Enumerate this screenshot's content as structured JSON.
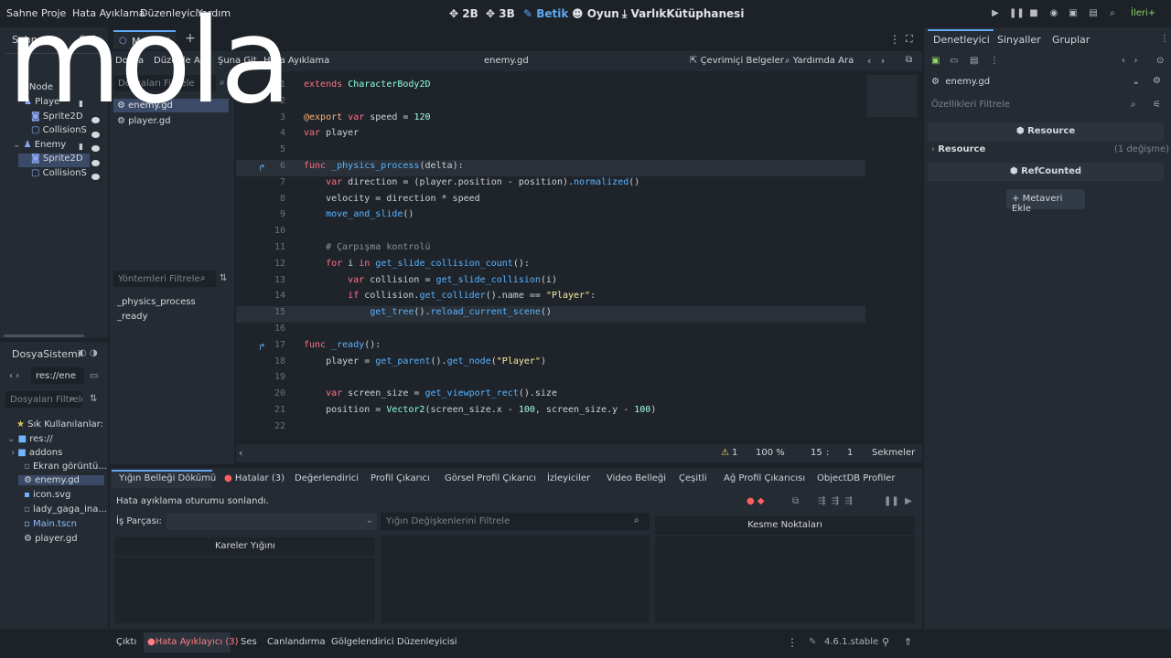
{
  "menu": [
    "Sahne",
    "Proje",
    "Hata Ayıklama",
    "Düzenleyici",
    "Yardım"
  ],
  "workspaces": [
    {
      "icon": "2d-icon",
      "label": "2B"
    },
    {
      "icon": "3d-icon",
      "label": "3B"
    },
    {
      "icon": "script-icon",
      "label": "Betik"
    },
    {
      "icon": "game-icon",
      "label": "Oyun"
    },
    {
      "icon": "asset-library-icon",
      "label": "VarlıkKütüphanesi"
    }
  ],
  "renderer": "İleri+",
  "overlay_text": "mola",
  "scene_panel": {
    "title": "Sahne",
    "nodes": [
      {
        "label": "Node2D",
        "display": "Node"
      },
      {
        "label": "Player",
        "display": "Playe"
      },
      {
        "label": "Sprite2D",
        "display": "Sprite2D"
      },
      {
        "label": "CollisionShape2D",
        "display": "CollisionS"
      },
      {
        "label": "Enemy",
        "display": "Enemy"
      },
      {
        "label": "Sprite2D",
        "display": "Sprite2D"
      },
      {
        "label": "CollisionShape2D",
        "display": "CollisionS"
      }
    ]
  },
  "editor_tabs": {
    "main_tab": "Main"
  },
  "script_menu": {
    "file": "Dosya",
    "edit": "Düzenle",
    "search": "Ara",
    "goto": "Şuna Git",
    "debug": "Hata Ayıklama"
  },
  "script_title": "enemy.gd",
  "online_docs": "Çevrimiçi Belgeler",
  "help_search": "Yardımda Ara",
  "script_filter_placeholder": "Dosyaları Filtrele",
  "script_list": [
    "enemy.gd",
    "player.gd"
  ],
  "method_filter_placeholder": "Yöntemleri Filtrele",
  "methods": [
    "_physics_process",
    "_ready"
  ],
  "code_lines": [
    {
      "n": "1",
      "html": "<span class='kw'>extends</span> <span class='ty'>CharacterBody2D</span>"
    },
    {
      "n": "2",
      "html": ""
    },
    {
      "n": "3",
      "html": "<span class='ann'>@export</span> <span class='kw'>var</span> speed = <span class='num'>120</span>"
    },
    {
      "n": "4",
      "html": "<span class='kw'>var</span> player"
    },
    {
      "n": "5",
      "html": ""
    },
    {
      "n": "6",
      "html": "<span class='kw'>func</span> <span class='fn'>_physics_process</span>(delta):"
    },
    {
      "n": "7",
      "html": "    <span class='kw'>var</span> direction = (player.position - position).<span class='fn'>normalized</span>()"
    },
    {
      "n": "8",
      "html": "    velocity = direction * speed"
    },
    {
      "n": "9",
      "html": "    <span class='fn'>move_and_slide</span>()"
    },
    {
      "n": "10",
      "html": ""
    },
    {
      "n": "11",
      "html": "    <span class='cm'># Çarpışma kontrolü</span>"
    },
    {
      "n": "12",
      "html": "    <span class='kw'>for</span> i <span class='kw'>in</span> <span class='fn'>get_slide_collision_count</span>():"
    },
    {
      "n": "13",
      "html": "        <span class='kw'>var</span> collision = <span class='fn'>get_slide_collision</span>(i)"
    },
    {
      "n": "14",
      "html": "        <span class='kw'>if</span> collision.<span class='fn'>get_collider</span>().name == <span class='str'>\"Player\"</span>:"
    },
    {
      "n": "15",
      "html": "            <span class='fn'>get_tree</span>().<span class='fn'>reload_current_scene</span>()"
    },
    {
      "n": "16",
      "html": ""
    },
    {
      "n": "17",
      "html": "<span class='kw'>func</span> <span class='fn'>_ready</span>():"
    },
    {
      "n": "18",
      "html": "    player = <span class='fn'>get_parent</span>().<span class='fn'>get_node</span>(<span class='str'>\"Player\"</span>)"
    },
    {
      "n": "19",
      "html": ""
    },
    {
      "n": "20",
      "html": "    <span class='kw'>var</span> screen_size = <span class='fn'>get_viewport_rect</span>().size"
    },
    {
      "n": "21",
      "html": "    position = <span class='ty'>Vector2</span>(screen_size.x - <span class='num'>100</span>, screen_size.y - <span class='num'>100</span>)"
    },
    {
      "n": "22",
      "html": ""
    }
  ],
  "status": {
    "warnings": "1",
    "zoom": "100 %",
    "line": "15",
    "sep": ":",
    "col": "1",
    "indent": "Sekmeler"
  },
  "filesystem": {
    "title": "DosyaSistemi",
    "path": "res://ene",
    "filter_placeholder": "Dosyaları Filtrele",
    "favorites": "Sık Kullanılanlar:",
    "root": "res://",
    "items": [
      "addons",
      "Ekran görüntü...",
      "enemy.gd",
      "icon.svg",
      "lady_gaga_ina...",
      "Main.tscn",
      "player.gd"
    ]
  },
  "inspector": {
    "tabs": [
      "Denetleyici",
      "Sinyaller",
      "Gruplar"
    ],
    "object": "enemy.gd",
    "filter_placeholder": "Özellikleri Filtrele",
    "resource_header": "Resource",
    "resource_row": "Resource",
    "changes": "(1 değişme)",
    "refcounted": "RefCounted",
    "add_metadata": "Metaveri Ekle"
  },
  "debugger": {
    "tabs": [
      "Yığın Belleği Dökümü",
      "Hatalar (3)",
      "Değerlendirici",
      "Profil Çıkarıcı",
      "Görsel Profil Çıkarıcı",
      "İzleyiciler",
      "Video Belleği",
      "Çeşitli",
      "Ağ Profil Çıkarıcısı",
      "ObjectDB Profiler"
    ],
    "message": "Hata ayıklama oturumu sonlandı.",
    "thread_label": "İş Parçası:",
    "stack_filter_placeholder": "Yığın Değişkenlerini Filtrele",
    "stack_frames": "Kareler Yığını",
    "breakpoints": "Kesme Noktaları"
  },
  "bottom_tabs": [
    "Çıktı",
    "Hata Ayıklayıcı (3)",
    "Ses",
    "Canlandırma",
    "Gölgelendirici Düzenleyicisi"
  ],
  "version": "4.6.1.stable"
}
